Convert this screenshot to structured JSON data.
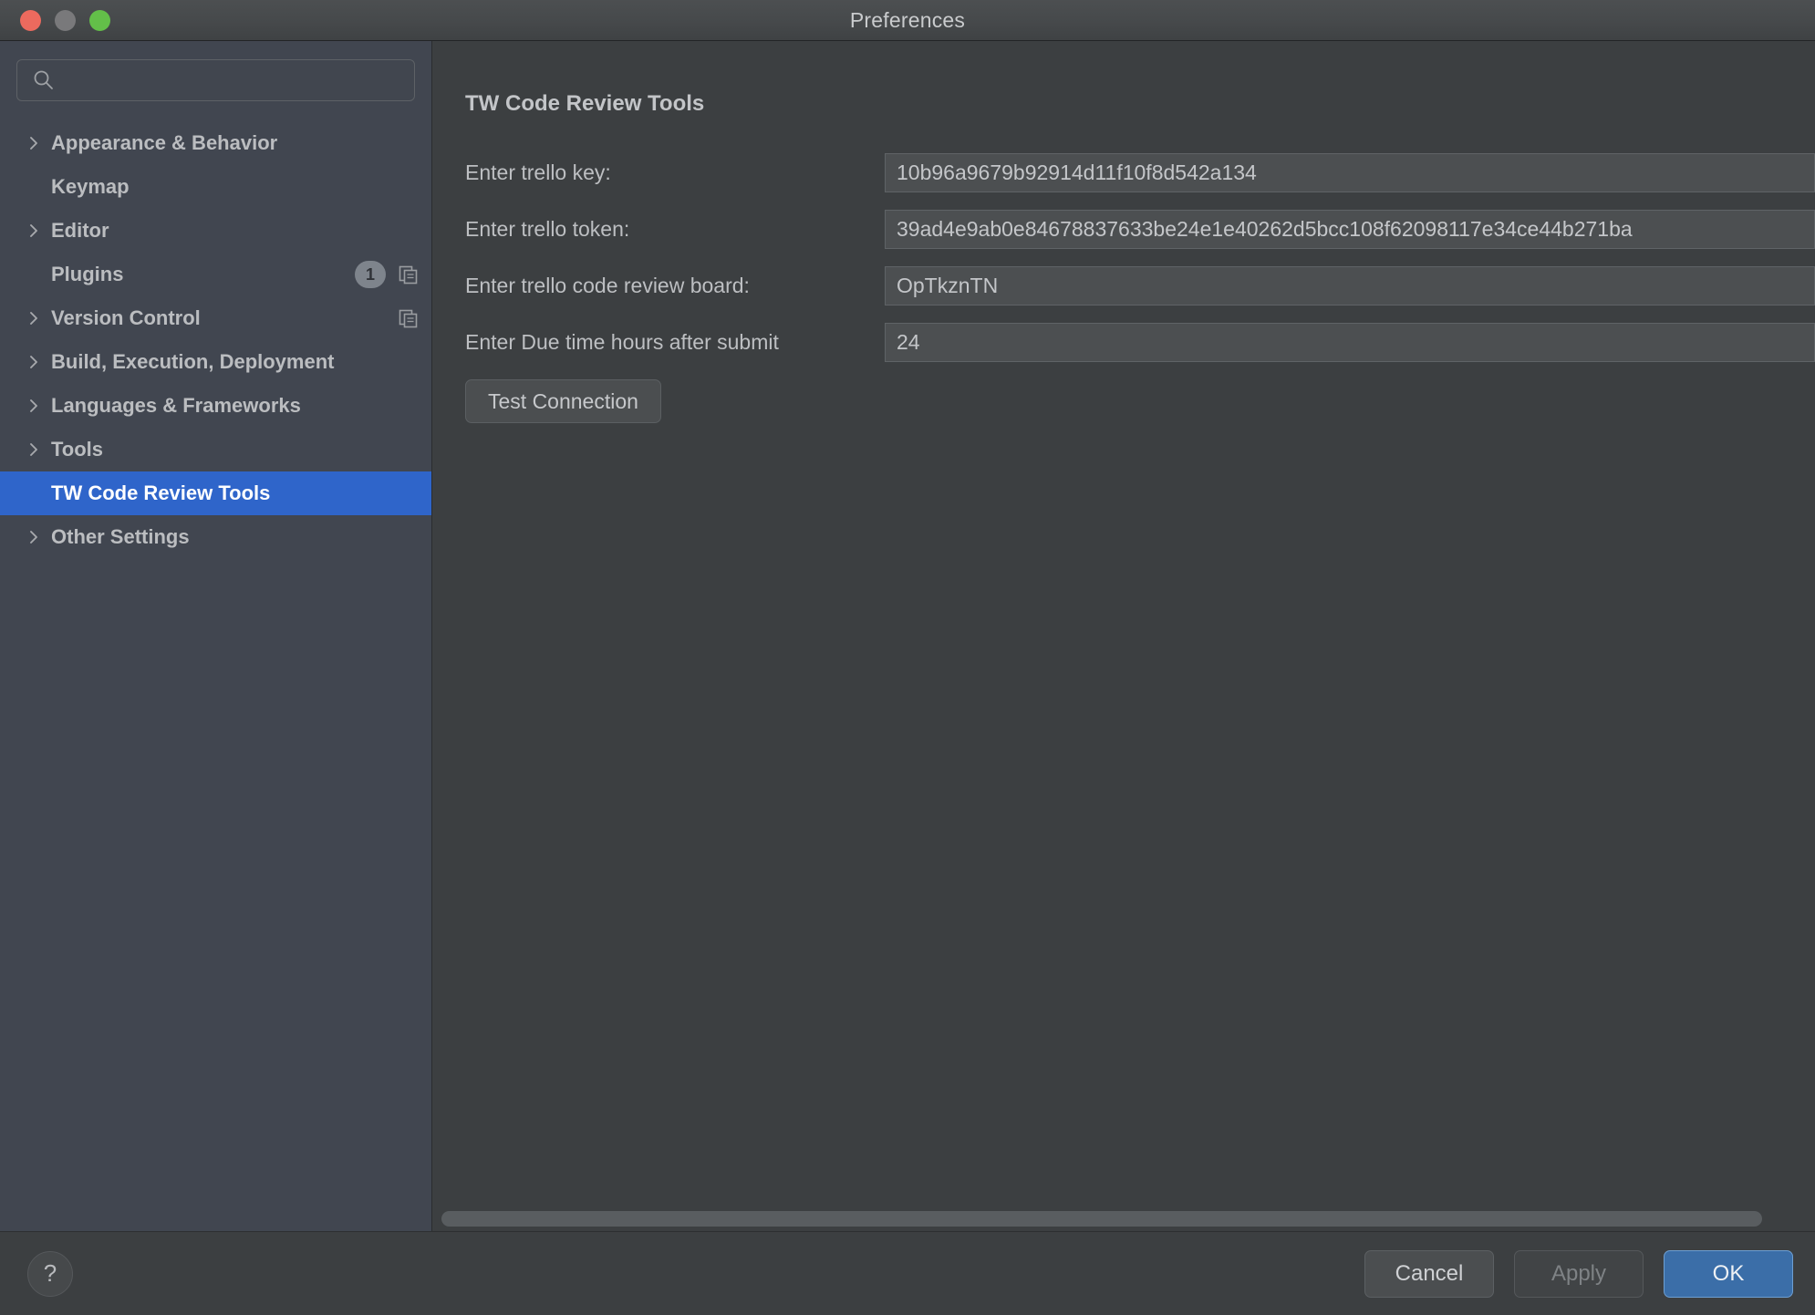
{
  "window": {
    "title": "Preferences",
    "traffic_lights": [
      {
        "name": "close-button",
        "color": "#ec6a5e"
      },
      {
        "name": "minimize-button",
        "color": "#79797b"
      },
      {
        "name": "zoom-button",
        "color": "#63bf49"
      }
    ]
  },
  "sidebar": {
    "search": {
      "value": "",
      "placeholder": ""
    },
    "items": [
      {
        "label": "Appearance & Behavior",
        "expandable": true,
        "selected": false,
        "badge": null,
        "copy_icon": false
      },
      {
        "label": "Keymap",
        "expandable": false,
        "selected": false,
        "badge": null,
        "copy_icon": false
      },
      {
        "label": "Editor",
        "expandable": true,
        "selected": false,
        "badge": null,
        "copy_icon": false
      },
      {
        "label": "Plugins",
        "expandable": false,
        "selected": false,
        "badge": "1",
        "copy_icon": true
      },
      {
        "label": "Version Control",
        "expandable": true,
        "selected": false,
        "badge": null,
        "copy_icon": true
      },
      {
        "label": "Build, Execution, Deployment",
        "expandable": true,
        "selected": false,
        "badge": null,
        "copy_icon": false
      },
      {
        "label": "Languages & Frameworks",
        "expandable": true,
        "selected": false,
        "badge": null,
        "copy_icon": false
      },
      {
        "label": "Tools",
        "expandable": true,
        "selected": false,
        "badge": null,
        "copy_icon": false
      },
      {
        "label": "TW Code Review Tools",
        "expandable": false,
        "selected": true,
        "badge": null,
        "copy_icon": false
      },
      {
        "label": "Other Settings",
        "expandable": true,
        "selected": false,
        "badge": null,
        "copy_icon": false
      }
    ]
  },
  "content": {
    "title": "TW Code Review Tools",
    "fields": [
      {
        "label": "Enter trello key:",
        "value": "10b96a9679b92914d11f10f8d542a134"
      },
      {
        "label": "Enter trello token:",
        "value": "39ad4e9ab0e84678837633be24e1e40262d5bcc108f62098117e34ce44b271ba"
      },
      {
        "label": "Enter trello code review board:",
        "value": "OpTkznTN"
      },
      {
        "label": "Enter Due time hours after submit",
        "value": "24"
      }
    ],
    "test_button": "Test Connection"
  },
  "footer": {
    "help": "?",
    "cancel": "Cancel",
    "apply": "Apply",
    "ok": "OK"
  },
  "colors": {
    "selection_blue": "#2f65ca",
    "ok_blue": "#3b6ea8",
    "sidebar_bg": "#414650",
    "content_bg": "#3c3f41"
  }
}
